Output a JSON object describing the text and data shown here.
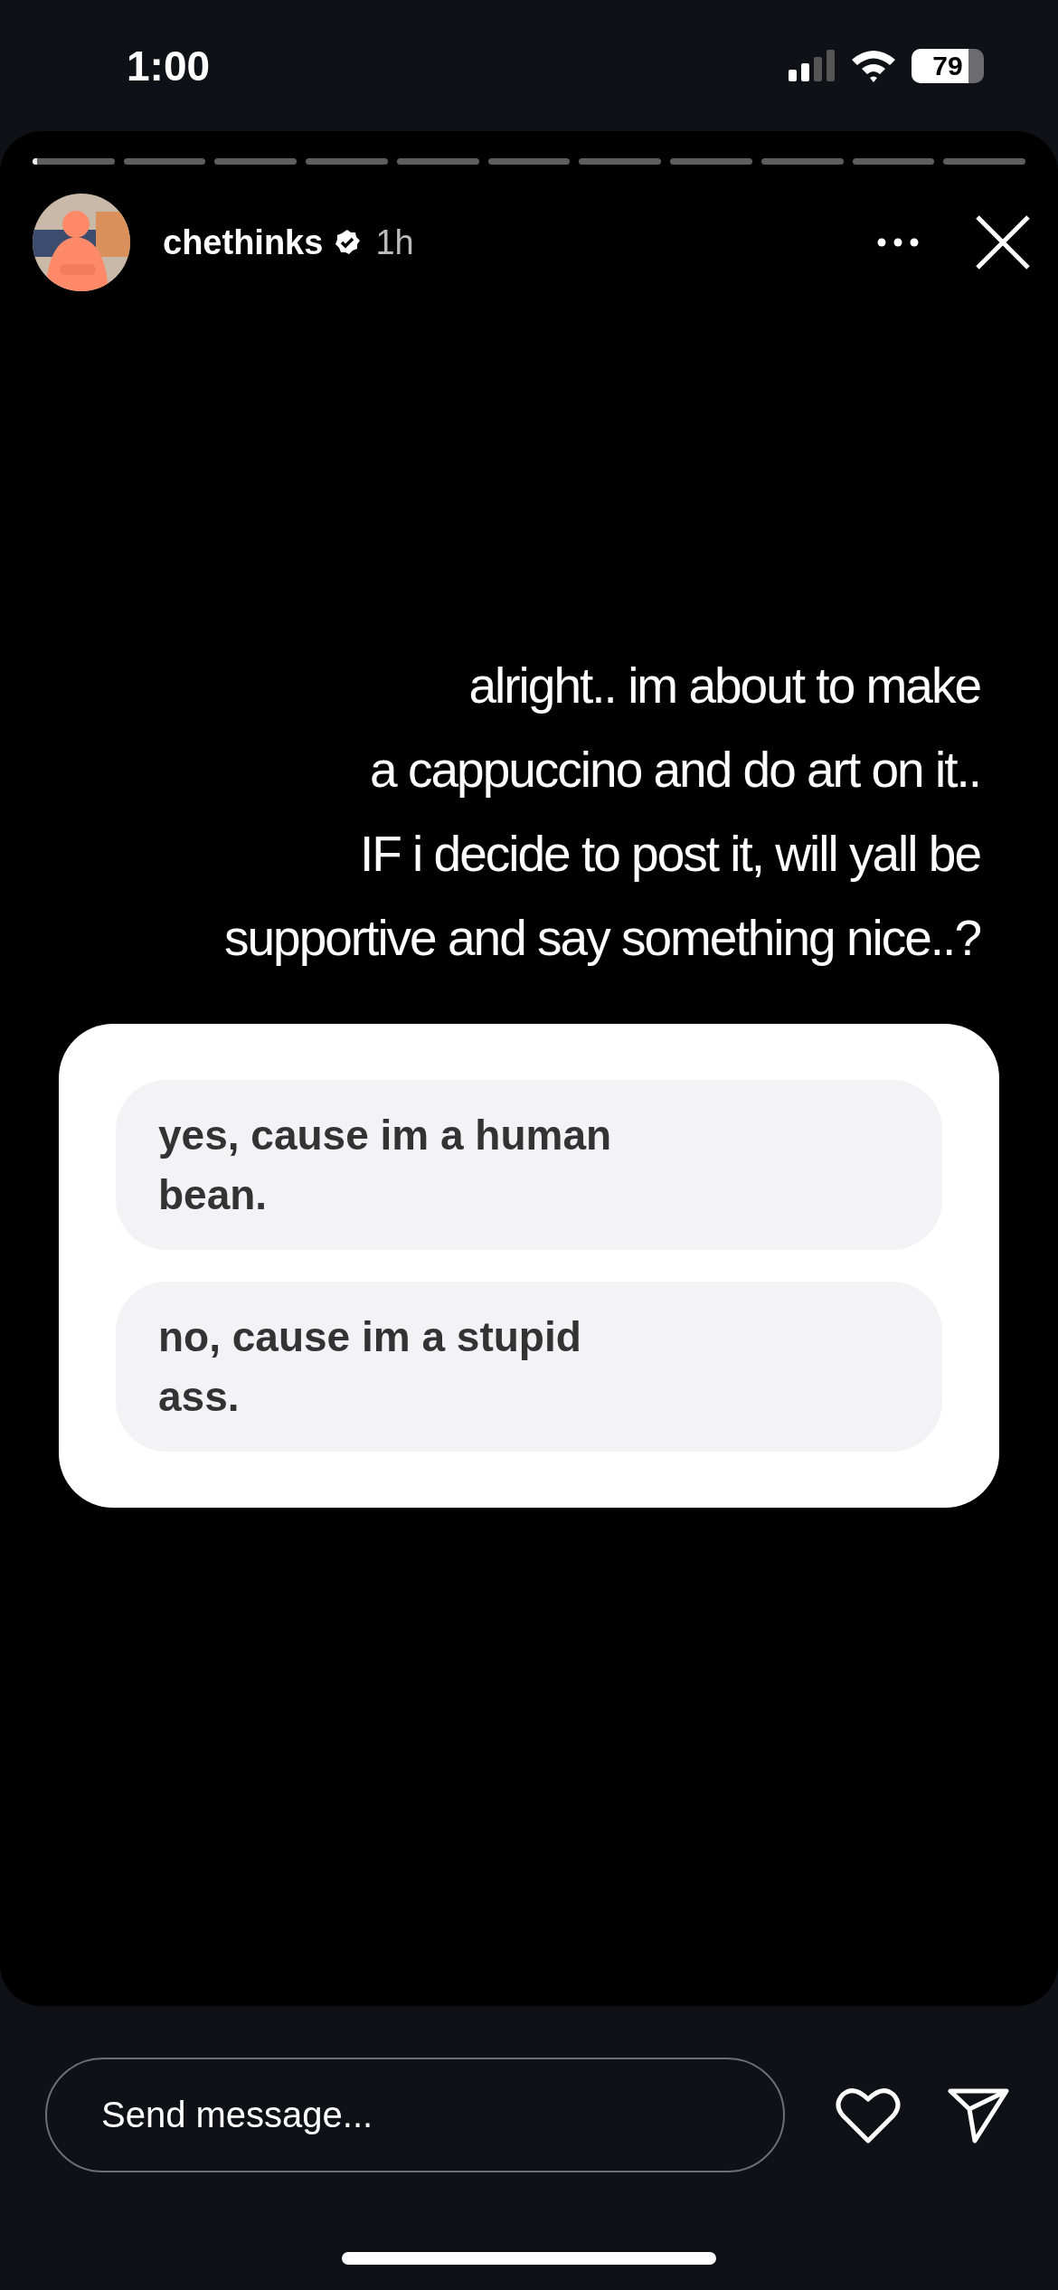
{
  "status_bar": {
    "time": "1:00",
    "battery": "79"
  },
  "progress": [
    {
      "active": true
    },
    {
      "active": false
    },
    {
      "active": false
    },
    {
      "active": false
    },
    {
      "active": false
    },
    {
      "active": false
    },
    {
      "active": false
    },
    {
      "active": false
    },
    {
      "active": false
    },
    {
      "active": false
    },
    {
      "active": false
    }
  ],
  "header": {
    "username": "chethinks",
    "verified": true,
    "time": "1h"
  },
  "caption": [
    "alright.. im about to make",
    "a cappuccino and do art on it..",
    "IF i decide to post it, will yall be",
    "supportive and say something nice..?"
  ],
  "poll": {
    "options": [
      {
        "label": "yes, cause im a human bean."
      },
      {
        "label": "no, cause im a stupid ass."
      }
    ]
  },
  "message": {
    "placeholder": "Send message..."
  }
}
